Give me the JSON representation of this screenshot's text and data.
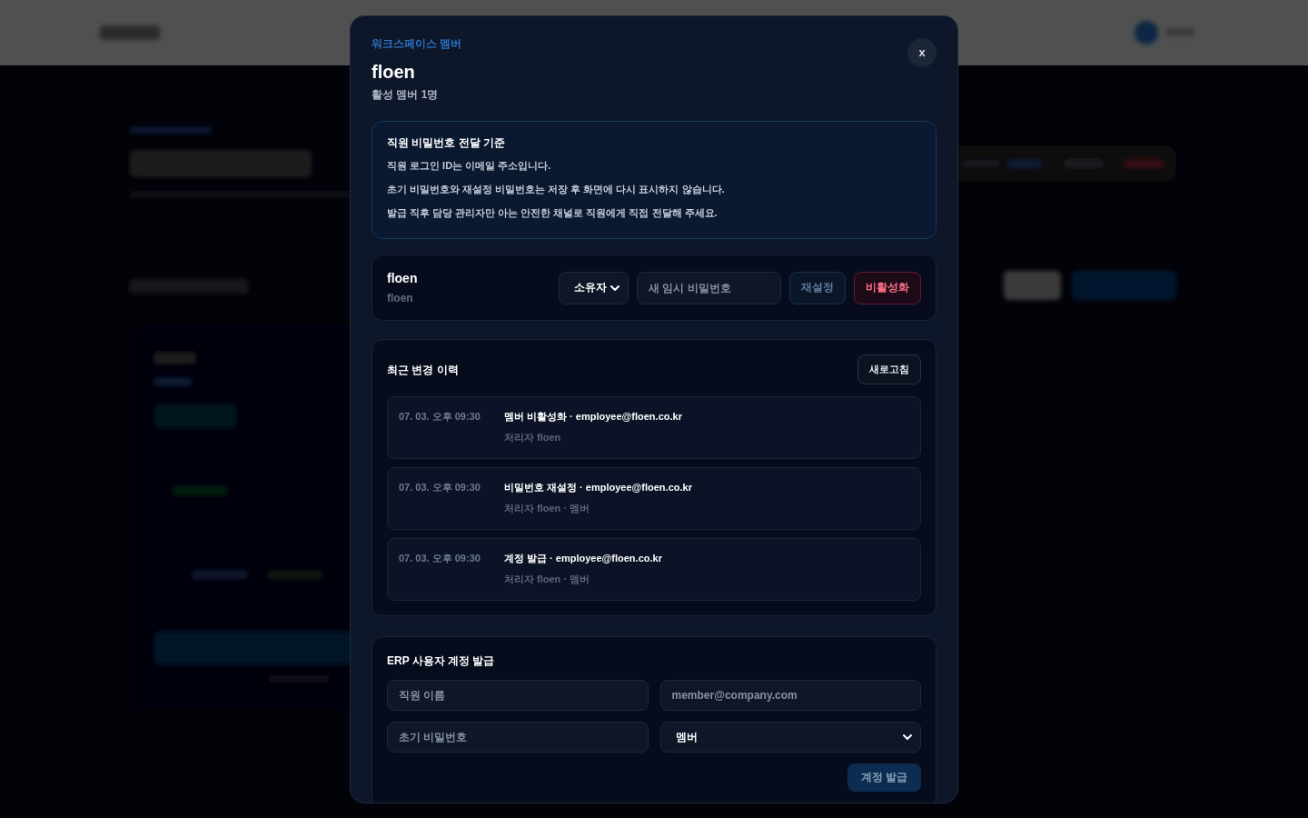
{
  "modal": {
    "eyebrow": "워크스페이스 멤버",
    "title": "floen",
    "subtitle": "활성 멤버 1명",
    "close_label": "x"
  },
  "notice": {
    "title": "직원 비밀번호 전달 기준",
    "lines": [
      "직원 로그인 ID는 이메일 주소입니다.",
      "초기 비밀번호와 재설정 비밀번호는 저장 후 화면에 다시 표시하지 않습니다.",
      "발급 직후 담당 관리자만 아는 안전한 채널로 직원에게 직접 전달해 주세요."
    ]
  },
  "members": [
    {
      "name": "floen",
      "login": "floen",
      "role": "소유자",
      "password_placeholder": "새 임시 비밀번호",
      "buttons": [
        {
          "label": "재설정",
          "kind": "secondary",
          "disabled": true
        },
        {
          "label": "비활성화",
          "kind": "danger",
          "disabled": false
        }
      ]
    }
  ],
  "history": {
    "title": "최근 변경 이력",
    "refresh_label": "새로고침",
    "entries": [
      {
        "time": "07. 03. 오후 09:30",
        "action": "멤버 비활성화 · employee@floen.co.kr",
        "actor": "처리자 floen"
      },
      {
        "time": "07. 03. 오후 09:30",
        "action": "비밀번호 재설정 · employee@floen.co.kr",
        "actor": "처리자 floen · 멤버"
      },
      {
        "time": "07. 03. 오후 09:30",
        "action": "계정 발급 · employee@floen.co.kr",
        "actor": "처리자 floen · 멤버"
      }
    ]
  },
  "issue_form": {
    "title": "ERP 사용자 계정 발급",
    "fields": [
      {
        "kind": "input",
        "placeholder": "직원 이름"
      },
      {
        "kind": "input",
        "placeholder": "member@company.com"
      },
      {
        "kind": "input",
        "placeholder": "초기 비밀번호"
      },
      {
        "kind": "select",
        "value": "멤버"
      }
    ],
    "submit": {
      "label": "계정 발급",
      "disabled": true
    }
  }
}
